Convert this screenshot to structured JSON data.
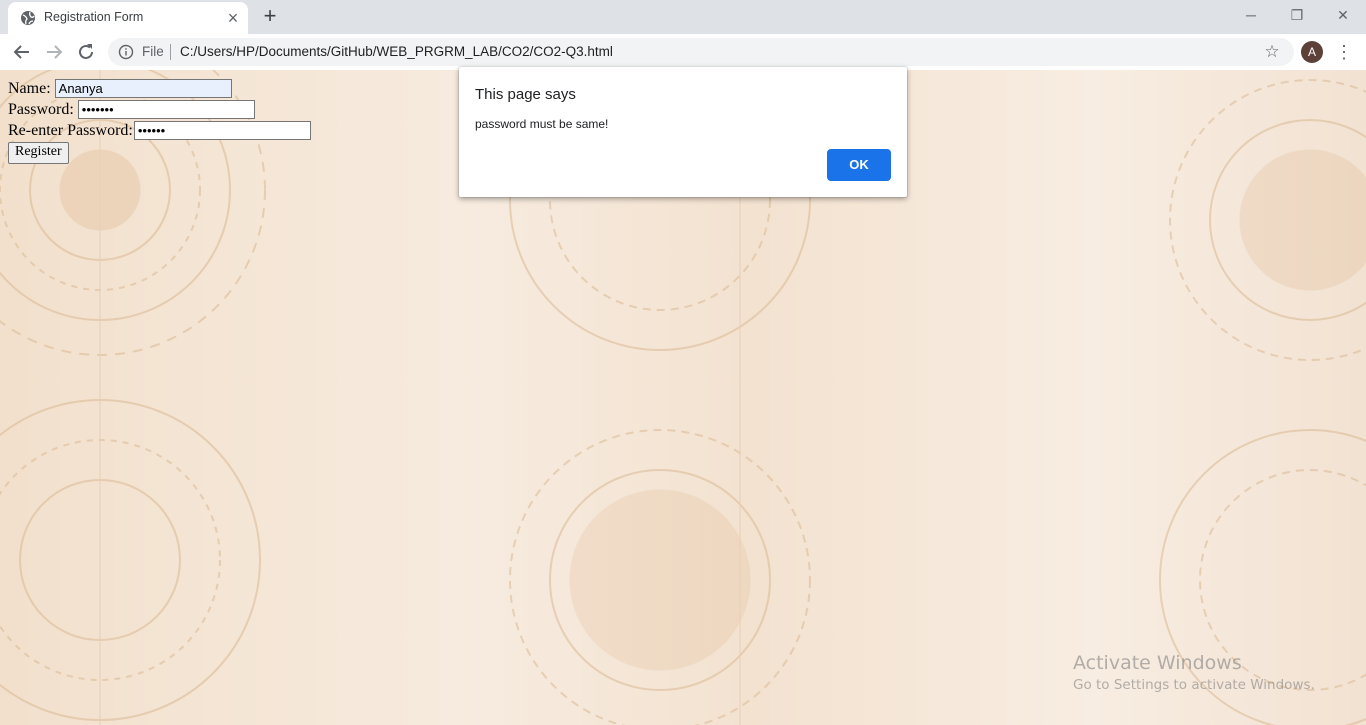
{
  "browser": {
    "tab": {
      "title": "Registration Form",
      "favicon": "globe-icon"
    },
    "window_controls": {
      "minimize": "─",
      "restore": "❐",
      "close": "✕"
    },
    "toolbar": {
      "scheme_label": "File",
      "url": "C:/Users/HP/Documents/GitHub/WEB_PRGRM_LAB/CO2/CO2-Q3.html",
      "profile_initial": "A"
    }
  },
  "form": {
    "name_label": "Name:",
    "name_value": "Ananya",
    "password_label": "Password:",
    "password_mask": "•••••••",
    "reenter_label": "Re-enter Password:",
    "reenter_mask": "••••••",
    "register_label": "Register"
  },
  "dialog": {
    "title": "This page says",
    "message": "password must be same!",
    "ok_label": "OK",
    "ok_color": "#1a73e8"
  },
  "watermark": {
    "title": "Activate Windows",
    "subtitle": "Go to Settings to activate Windows."
  }
}
